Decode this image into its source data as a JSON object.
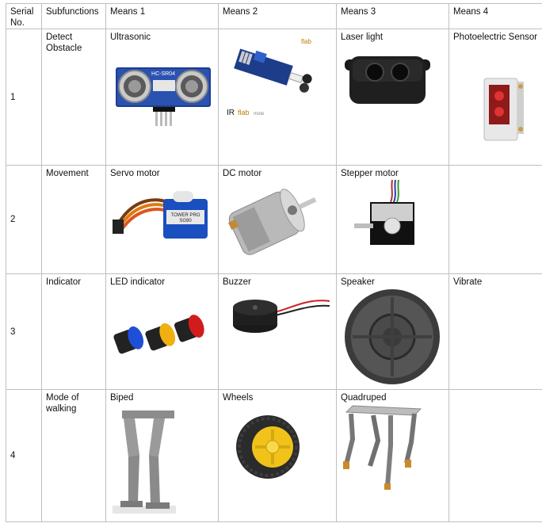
{
  "table": {
    "headers": [
      "Serial No.",
      "Subfunctions",
      "Means 1",
      "Means 2",
      "Means 3",
      "Means 4"
    ],
    "rows": [
      {
        "serial": "1",
        "subfunction": "Detect Obstacle",
        "means": [
          {
            "label": "Ultrasonic",
            "image": "ultrasonic-sensor",
            "sensor_text": "HC-SR04"
          },
          {
            "label": "",
            "image": "ir-sensor-module",
            "caption": "IR",
            "brand_text": "flab",
            "brand_suffix": "mote"
          },
          {
            "label": "Laser light",
            "image": "laser-rangefinder"
          },
          {
            "label": "Photoelectric Sensor",
            "image": "photoelectric-sensor"
          }
        ]
      },
      {
        "serial": "2",
        "subfunction": "Movement",
        "means": [
          {
            "label": "Servo motor",
            "image": "servo-motor",
            "brand_text": "TOWER PRO",
            "model_text": "SG90"
          },
          {
            "label": "DC motor",
            "image": "dc-motor"
          },
          {
            "label": "Stepper motor",
            "image": "stepper-motor"
          },
          {
            "label": "",
            "image": ""
          }
        ]
      },
      {
        "serial": "3",
        "subfunction": "Indicator",
        "means": [
          {
            "label": "LED indicator",
            "image": "led-indicators"
          },
          {
            "label": "Buzzer",
            "image": "buzzer"
          },
          {
            "label": "Speaker",
            "image": "speaker"
          },
          {
            "label": "Vibrate",
            "image": ""
          }
        ]
      },
      {
        "serial": "4",
        "subfunction": "Mode of walking",
        "means": [
          {
            "label": "Biped",
            "image": "biped-robot-legs"
          },
          {
            "label": "Wheels",
            "image": "wheel"
          },
          {
            "label": "Quadruped",
            "image": "quadruped-robot"
          },
          {
            "label": "",
            "image": ""
          }
        ]
      }
    ]
  }
}
